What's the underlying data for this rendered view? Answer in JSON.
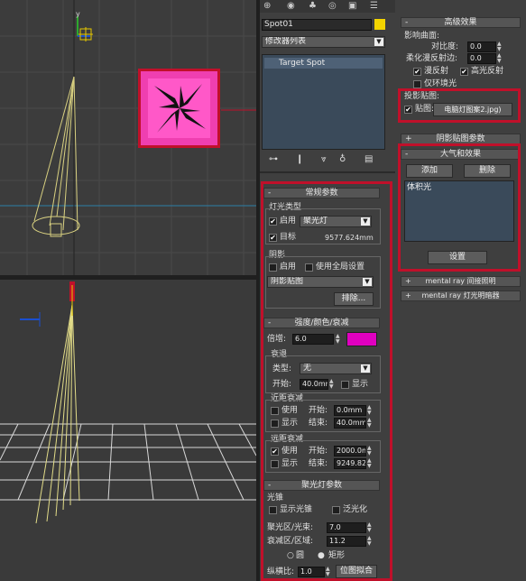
{
  "colors": {
    "accent_red": "#c0102a",
    "swatch_yellow": "#f3d400",
    "swatch_magenta": "#e000c0",
    "gobo_pink": "#ef3fb0"
  },
  "viewport_top": {
    "axis_y": "y"
  },
  "modify": {
    "name": "Spot01",
    "modifier_list": "修改器列表",
    "stack_item": "Target Spot"
  },
  "general": {
    "title": "常规参数",
    "light_type_group": "灯光类型",
    "enable": "启用",
    "light_type": "聚光灯",
    "target": "目标",
    "target_distance": "9577.624mm",
    "shadow_group": "阴影",
    "shadow_enable": "启用",
    "use_global": "使用全局设置",
    "shadow_type": "阴影贴图",
    "exclude": "排除..."
  },
  "intensity": {
    "title": "强度/颜色/衰减",
    "multiplier_label": "倍增:",
    "multiplier": "6.0",
    "decay_group": "衰退",
    "type_label": "类型:",
    "type_value": "无",
    "start_label": "开始:",
    "start_value": "40.0mm",
    "show": "显示",
    "near_group": "近距衰减",
    "near_use": "使用",
    "near_start_label": "开始:",
    "near_start": "0.0mm",
    "near_show": "显示",
    "near_end_label": "结束:",
    "near_end": "40.0mm",
    "far_group": "远距衰减",
    "far_use": "使用",
    "far_start_label": "开始:",
    "far_start": "2000.0m",
    "far_show": "显示",
    "far_end_label": "结束:",
    "far_end": "9249.82"
  },
  "spot": {
    "title": "聚光灯参数",
    "cone_group": "光锥",
    "show_cone": "显示光锥",
    "overshoot": "泛光化",
    "hotspot_label": "聚光区/光束:",
    "hotspot": "7.0",
    "falloff_label": "衰减区/区域:",
    "falloff": "11.2",
    "circle": "圆",
    "rectangle": "矩形",
    "aspect_label": "纵横比:",
    "aspect": "1.0",
    "bitmap_fit": "位图拟合"
  },
  "advanced": {
    "title": "高级效果",
    "affect_surfaces": "影响曲面:",
    "contrast_label": "对比度:",
    "contrast": "0.0",
    "soften_label": "柔化漫反射边:",
    "soften": "0.0",
    "diffuse": "漫反射",
    "specular": "高光反射",
    "ambient_only": "仅环境光",
    "projector_group": "投影贴图:",
    "map_label": "贴图:",
    "map_file": "电脑灯图案2.jpg)"
  },
  "shadow_map_params": {
    "title": "阴影贴图参数"
  },
  "atmos": {
    "title": "大气和效果",
    "add": "添加",
    "delete": "删除",
    "items": [
      "体积光"
    ],
    "setup": "设置"
  },
  "mr_indirect": {
    "title": "mental ray 间接照明"
  },
  "mr_shaders": {
    "title": "mental ray 灯光明暗器"
  }
}
